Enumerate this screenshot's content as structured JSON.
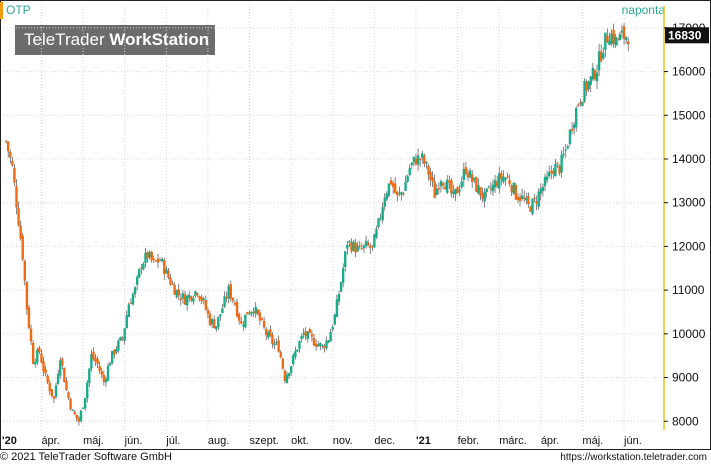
{
  "header": {
    "symbol": "OTP",
    "period": "naponta",
    "logo_regular": "TeleTrader",
    "logo_bold": "WorkStation"
  },
  "footer": {
    "copyright": "© 2021 TeleTrader Software GmbH",
    "url": "https://workstation.teletrader.com"
  },
  "colors": {
    "up": "#1aab8a",
    "down": "#f06a14",
    "accent": "#f39c12",
    "axis": "#e8c21a",
    "label_bg": "#111111"
  },
  "chart_data": {
    "type": "candlestick",
    "symbol": "OTP",
    "period": "naponta",
    "last_value_label": "16830",
    "ylim": [
      7800,
      17500
    ],
    "y_ticks": [
      8000,
      9000,
      10000,
      11000,
      12000,
      13000,
      14000,
      15000,
      16000,
      17000
    ],
    "x_ticks": [
      {
        "label": "'20",
        "bold": true,
        "month_index": 2
      },
      {
        "label": "ápr.",
        "month_index": 3
      },
      {
        "label": "máj.",
        "month_index": 4
      },
      {
        "label": "jún.",
        "month_index": 5
      },
      {
        "label": "júl.",
        "month_index": 6
      },
      {
        "label": "aug.",
        "month_index": 7
      },
      {
        "label": "szept.",
        "month_index": 8
      },
      {
        "label": "okt.",
        "month_index": 9
      },
      {
        "label": "nov.",
        "month_index": 10
      },
      {
        "label": "dec.",
        "month_index": 11
      },
      {
        "label": "'21",
        "bold": true,
        "month_index": 12
      },
      {
        "label": "febr.",
        "month_index": 13
      },
      {
        "label": "márc.",
        "month_index": 14
      },
      {
        "label": "ápr.",
        "month_index": 15
      },
      {
        "label": "máj.",
        "month_index": 16
      },
      {
        "label": "jún.",
        "month_index": 17
      }
    ],
    "x_range": [
      2.1,
      17.96
    ],
    "closes": [
      [
        2.15,
        14400
      ],
      [
        2.3,
        13800
      ],
      [
        2.45,
        12600
      ],
      [
        2.55,
        11800
      ],
      [
        2.65,
        10600
      ],
      [
        2.8,
        9400
      ],
      [
        2.95,
        9600
      ],
      [
        3.1,
        9000
      ],
      [
        3.3,
        8500
      ],
      [
        3.45,
        9500
      ],
      [
        3.6,
        8700
      ],
      [
        3.75,
        8200
      ],
      [
        3.9,
        8000
      ],
      [
        4.05,
        8600
      ],
      [
        4.2,
        9500
      ],
      [
        4.35,
        9300
      ],
      [
        4.5,
        8900
      ],
      [
        4.65,
        9400
      ],
      [
        4.8,
        9700
      ],
      [
        4.95,
        9900
      ],
      [
        5.1,
        10700
      ],
      [
        5.25,
        11000
      ],
      [
        5.4,
        11600
      ],
      [
        5.55,
        11800
      ],
      [
        5.7,
        11600
      ],
      [
        5.85,
        11700
      ],
      [
        6.0,
        11400
      ],
      [
        6.15,
        11100
      ],
      [
        6.3,
        10900
      ],
      [
        6.45,
        10800
      ],
      [
        6.6,
        10900
      ],
      [
        6.75,
        11000
      ],
      [
        6.9,
        10700
      ],
      [
        7.05,
        10300
      ],
      [
        7.2,
        10200
      ],
      [
        7.35,
        10600
      ],
      [
        7.5,
        11000
      ],
      [
        7.65,
        10700
      ],
      [
        7.8,
        10200
      ],
      [
        7.95,
        10500
      ],
      [
        8.1,
        10600
      ],
      [
        8.25,
        10300
      ],
      [
        8.4,
        10000
      ],
      [
        8.55,
        9800
      ],
      [
        8.7,
        9700
      ],
      [
        8.85,
        9000
      ],
      [
        9.0,
        9300
      ],
      [
        9.15,
        9700
      ],
      [
        9.3,
        10000
      ],
      [
        9.45,
        9900
      ],
      [
        9.6,
        9800
      ],
      [
        9.75,
        9700
      ],
      [
        9.9,
        9900
      ],
      [
        10.05,
        10400
      ],
      [
        10.2,
        11200
      ],
      [
        10.35,
        12100
      ],
      [
        10.5,
        12000
      ],
      [
        10.65,
        11900
      ],
      [
        10.8,
        12000
      ],
      [
        10.95,
        11950
      ],
      [
        11.1,
        12500
      ],
      [
        11.25,
        13200
      ],
      [
        11.4,
        13500
      ],
      [
        11.55,
        13100
      ],
      [
        11.7,
        13300
      ],
      [
        11.85,
        13800
      ],
      [
        12.0,
        14000
      ],
      [
        12.15,
        14000
      ],
      [
        12.3,
        13700
      ],
      [
        12.45,
        13200
      ],
      [
        12.6,
        13600
      ],
      [
        12.75,
        13400
      ],
      [
        12.9,
        13100
      ],
      [
        13.05,
        13400
      ],
      [
        13.2,
        13800
      ],
      [
        13.35,
        13500
      ],
      [
        13.5,
        13300
      ],
      [
        13.65,
        13100
      ],
      [
        13.8,
        13300
      ],
      [
        13.95,
        13500
      ],
      [
        14.1,
        13600
      ],
      [
        14.25,
        13500
      ],
      [
        14.4,
        13200
      ],
      [
        14.55,
        13100
      ],
      [
        14.7,
        12900
      ],
      [
        14.85,
        13000
      ],
      [
        15.0,
        13300
      ],
      [
        15.15,
        13500
      ],
      [
        15.3,
        13800
      ],
      [
        15.45,
        13800
      ],
      [
        15.6,
        14200
      ],
      [
        15.75,
        14800
      ],
      [
        15.9,
        15300
      ],
      [
        16.05,
        15600
      ],
      [
        16.2,
        15800
      ],
      [
        16.35,
        16100
      ],
      [
        16.5,
        16600
      ],
      [
        16.65,
        16900
      ],
      [
        16.8,
        16700
      ],
      [
        16.95,
        16800
      ],
      [
        17.1,
        16830
      ]
    ]
  }
}
